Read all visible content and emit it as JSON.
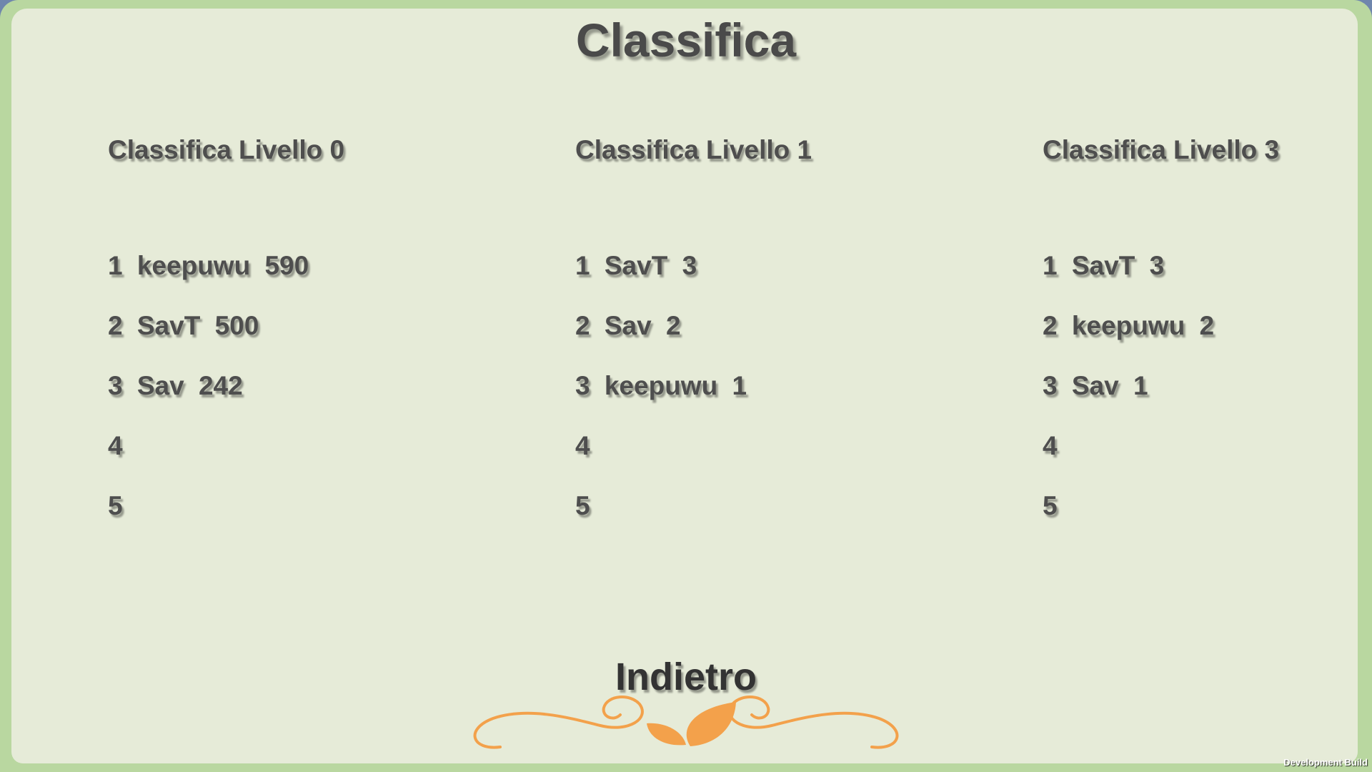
{
  "title": "Classifica",
  "leaderboards": [
    {
      "header": "Classifica Livello 0",
      "entries": [
        {
          "rank": "1",
          "name": "keepuwu",
          "score": "590"
        },
        {
          "rank": "2",
          "name": "SavT",
          "score": "500"
        },
        {
          "rank": "3",
          "name": "Sav",
          "score": "242"
        },
        {
          "rank": "4",
          "name": "",
          "score": ""
        },
        {
          "rank": "5",
          "name": "",
          "score": ""
        }
      ]
    },
    {
      "header": "Classifica Livello 1",
      "entries": [
        {
          "rank": "1",
          "name": "SavT",
          "score": "3"
        },
        {
          "rank": "2",
          "name": "Sav",
          "score": "2"
        },
        {
          "rank": "3",
          "name": "keepuwu",
          "score": "1"
        },
        {
          "rank": "4",
          "name": "",
          "score": ""
        },
        {
          "rank": "5",
          "name": "",
          "score": ""
        }
      ]
    },
    {
      "header": "Classifica Livello 3",
      "entries": [
        {
          "rank": "1",
          "name": "SavT",
          "score": "3"
        },
        {
          "rank": "2",
          "name": "keepuwu",
          "score": "2"
        },
        {
          "rank": "3",
          "name": "Sav",
          "score": "1"
        },
        {
          "rank": "4",
          "name": "",
          "score": ""
        },
        {
          "rank": "5",
          "name": "",
          "score": ""
        }
      ]
    }
  ],
  "back_button": {
    "label": "Indietro",
    "ornament_icon": "leaf-flourish-icon"
  },
  "footer": {
    "dev_build": "Development Build"
  },
  "colors": {
    "frame": "#b9d7a0",
    "panel": "#e6ebd8",
    "text": "#4e4e4e",
    "ornament": "#f3a14b"
  }
}
